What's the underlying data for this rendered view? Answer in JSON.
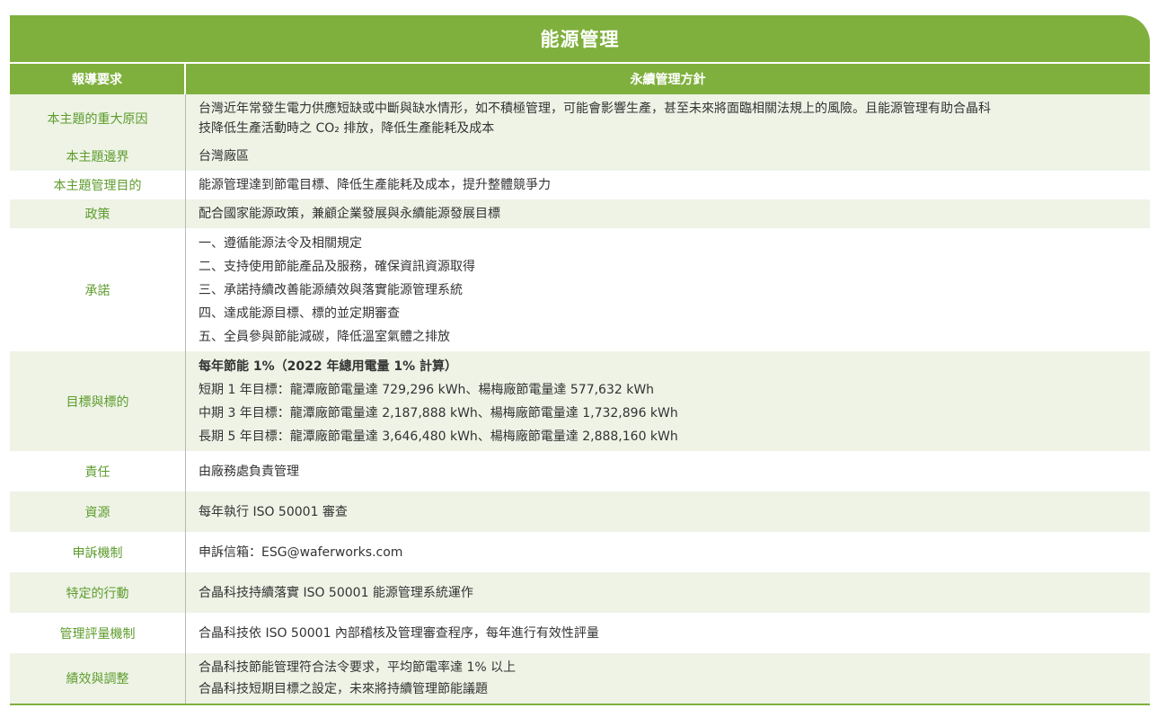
{
  "title": "能源管理",
  "headers": {
    "col1": "報導要求",
    "col2": "永續管理方針"
  },
  "rows": [
    {
      "label": "本主題的重大原因",
      "lines": [
        "台灣近年常發生電力供應短缺或中斷與缺水情形，如不積極管理，可能會影響生產，甚至未來將面臨相關法規上的風險。且能源管理有助合晶科",
        "技降低生產活動時之 CO₂ 排放，降低生產能耗及成本"
      ]
    },
    {
      "label": "本主題邊界",
      "lines": [
        "台灣廠區"
      ]
    },
    {
      "label": "本主題管理目的",
      "lines": [
        "能源管理達到節電目標、降低生產能耗及成本，提升整體競爭力"
      ]
    },
    {
      "label": "政策",
      "lines": [
        "配合國家能源政策，兼顧企業發展與永續能源發展目標"
      ]
    },
    {
      "label": "承諾",
      "lines": [
        "一、遵循能源法令及相關規定",
        "二、支持使用節能產品及服務，確保資訊資源取得",
        "三、承諾持續改善能源績效與落實能源管理系統",
        "四、達成能源目標、標的並定期審查",
        "五、全員參與節能減碳，降低溫室氣體之排放"
      ]
    },
    {
      "label": "目標與標的",
      "lines": [
        "每年節能 1%（2022 年總用電量 1% 計算）",
        "短期 1 年目標：龍潭廠節電量達 729,296 kWh、楊梅廠節電量達 577,632 kWh",
        "中期 3 年目標：龍潭廠節電量達 2,187,888 kWh、楊梅廠節電量達 1,732,896 kWh",
        "長期 5 年目標：龍潭廠節電量達 3,646,480 kWh、楊梅廠節電量達 2,888,160 kWh"
      ]
    },
    {
      "label": "責任",
      "lines": [
        "由廠務處負責管理"
      ]
    },
    {
      "label": "資源",
      "lines": [
        "每年執行 ISO 50001 審查"
      ]
    },
    {
      "label": "申訴機制",
      "lines": [
        "申訴信箱：ESG@waferworks.com"
      ]
    },
    {
      "label": "特定的行動",
      "lines": [
        "合晶科技持續落實 ISO 50001 能源管理系統運作"
      ]
    },
    {
      "label": "管理評量機制",
      "lines": [
        "合晶科技依 ISO 50001 內部稽核及管理審查程序，每年進行有效性評量"
      ]
    },
    {
      "label": "績效與調整",
      "lines": [
        "合晶科技節能管理符合法令要求，平均節電率達 1% 以上",
        "合晶科技短期目標之設定，未來將持續管理節能議題"
      ]
    }
  ]
}
